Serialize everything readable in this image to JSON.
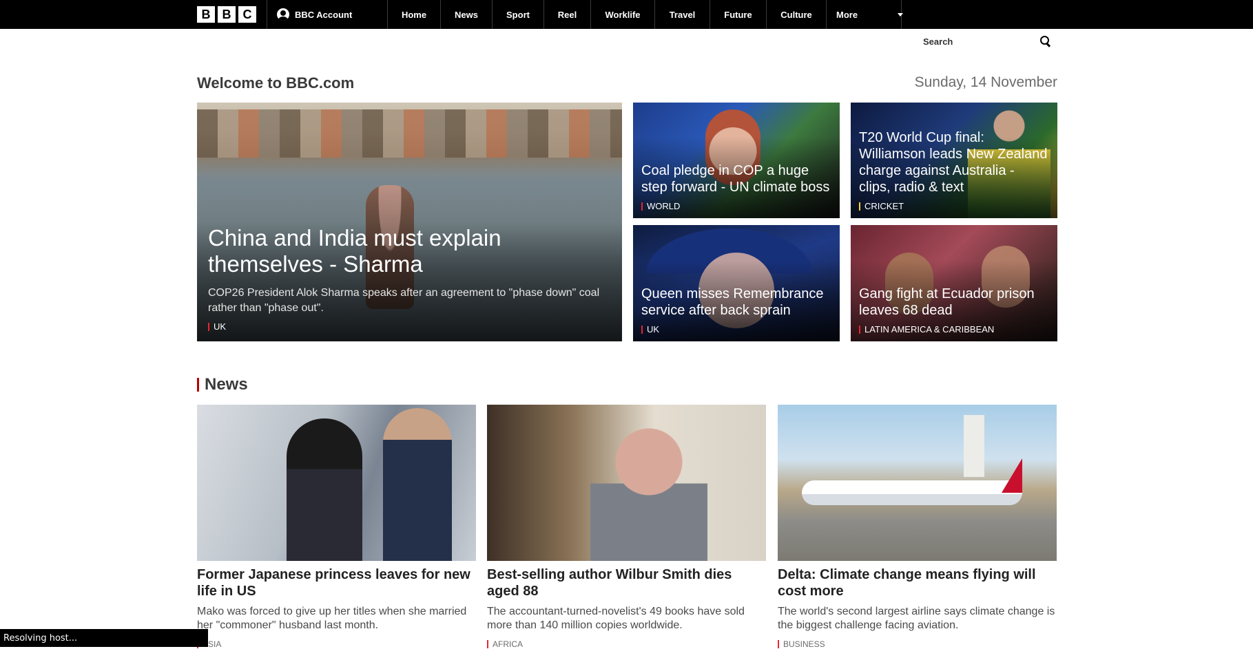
{
  "header": {
    "logo_letters": [
      "B",
      "B",
      "C"
    ],
    "account_label": "BBC Account",
    "nav": [
      "Home",
      "News",
      "Sport",
      "Reel",
      "Worklife",
      "Travel",
      "Future",
      "Culture",
      "More"
    ]
  },
  "search": {
    "placeholder": "Search"
  },
  "page": {
    "welcome": "Welcome to BBC.com",
    "date": "Sunday, 14 November"
  },
  "hero": {
    "main": {
      "headline": "China and India must explain themselves - Sharma",
      "summary": "COP26 President Alok Sharma speaks after an agreement to \"phase down\" coal rather than \"phase out\".",
      "tag": "UK"
    },
    "tiles": [
      {
        "headline": "Coal pledge in COP a huge step forward - UN climate boss",
        "tag": "WORLD",
        "tag_color": "#e6262e"
      },
      {
        "headline": "T20 World Cup final: Williamson leads New Zealand charge against Australia - clips, radio & text",
        "tag": "CRICKET",
        "tag_color": "#ffd230"
      },
      {
        "headline": "Queen misses Remembrance service after back sprain",
        "tag": "UK",
        "tag_color": "#e6262e"
      },
      {
        "headline": "Gang fight at Ecuador prison leaves 68 dead",
        "tag": "LATIN AMERICA & CARIBBEAN",
        "tag_color": "#e6262e"
      }
    ]
  },
  "news": {
    "title": "News",
    "cards": [
      {
        "headline": "Former Japanese princess leaves for new life in US",
        "summary": "Mako was forced to give up her titles when she married her \"commoner\" husband last month.",
        "tag": "ASIA"
      },
      {
        "headline": "Best-selling author Wilbur Smith dies aged 88",
        "summary": "The accountant-turned-novelist's 49 books have sold more than 140 million copies worldwide.",
        "tag": "AFRICA"
      },
      {
        "headline": "Delta: Climate change means flying will cost more",
        "summary": "The world's second largest airline says climate change is the biggest challenge facing aviation.",
        "tag": "BUSINESS"
      }
    ]
  },
  "status_bar": "Resolving host...",
  "colors": {
    "accent_red": "#b80000",
    "nav_bg": "#000000"
  }
}
